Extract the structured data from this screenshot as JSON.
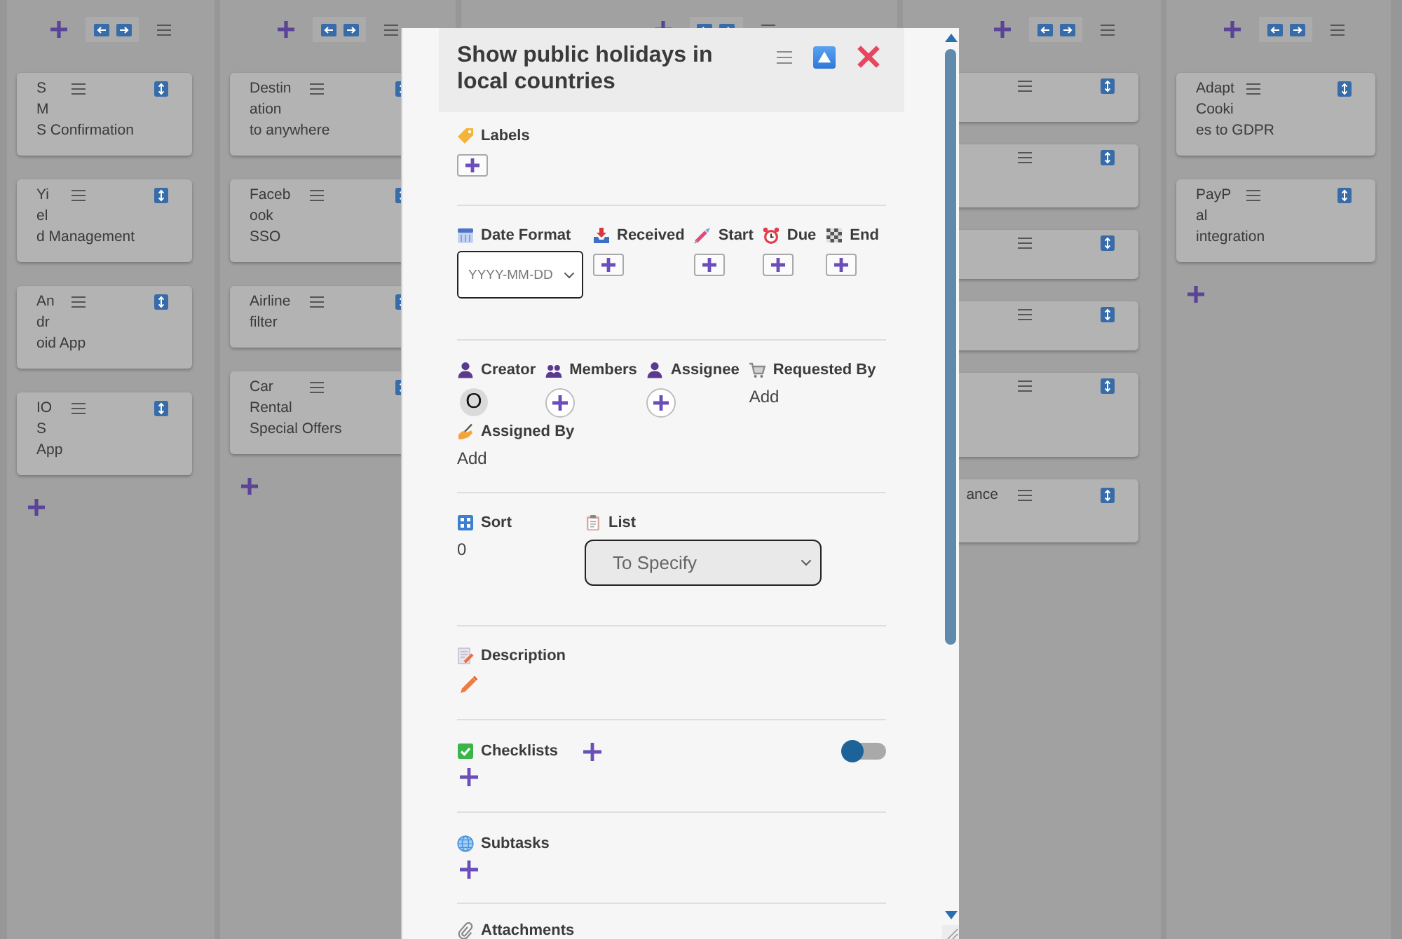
{
  "board": {
    "columns": [
      {
        "cards": [
          {
            "kind": "card",
            "title_lines": [
              "S",
              "M",
              "S Confirmation"
            ]
          },
          {
            "kind": "card",
            "title_lines": [
              "Yi",
              "el",
              "d Management"
            ]
          },
          {
            "kind": "card",
            "title_lines": [
              "An",
              "dr",
              "oid App"
            ]
          },
          {
            "kind": "card",
            "title_lines": [
              "IO",
              "S",
              "App"
            ]
          }
        ]
      },
      {
        "cards": [
          {
            "kind": "card",
            "title_lines": [
              "Destin",
              "ation",
              "to anywhere"
            ]
          },
          {
            "kind": "card",
            "title_lines": [
              "Faceb",
              "ook",
              "SSO"
            ]
          },
          {
            "kind": "card",
            "title_lines": [
              "Airline",
              "filter"
            ]
          },
          {
            "kind": "card",
            "title_lines": [
              "Car",
              "Rental",
              "Special Offers"
            ]
          }
        ]
      },
      {},
      {
        "cards": [
          {
            "kind": "clipped"
          },
          {
            "kind": "clipped"
          },
          {
            "kind": "clipped"
          },
          {
            "kind": "clipped"
          },
          {
            "kind": "clipped"
          },
          {
            "kind": "clipped",
            "title_lines": [
              "ance"
            ]
          }
        ]
      },
      {
        "cards": [
          {
            "kind": "card",
            "title_lines": [
              "Adapt",
              "Cooki",
              "es to GDPR"
            ]
          },
          {
            "kind": "card",
            "title_lines": [
              "PayP",
              "al",
              "integration"
            ]
          }
        ]
      }
    ]
  },
  "card_dialog": {
    "title": "Show public holidays in local countries",
    "sections": [
      {
        "fields": [
          {
            "kind": "add-box",
            "label": "Labels"
          }
        ]
      },
      {
        "fields": [
          {
            "kind": "date-select",
            "label": "Date Format",
            "placeholder": "YYYY-MM-DD"
          },
          {
            "kind": "add-box",
            "label": "Received"
          },
          {
            "kind": "add-box",
            "label": "Start"
          },
          {
            "kind": "add-box",
            "label": "Due"
          },
          {
            "kind": "add-box",
            "label": "End"
          }
        ]
      },
      {
        "fields": [
          {
            "kind": "avatar",
            "label": "Creator",
            "initial": "O"
          },
          {
            "kind": "add-circle",
            "label": "Members"
          },
          {
            "kind": "add-circle",
            "label": "Assignee"
          },
          {
            "kind": "link",
            "label": "Requested By",
            "value": "Add"
          },
          {
            "kind": "link",
            "label": "Assigned By",
            "value": "Add"
          }
        ]
      },
      {
        "fields": [
          {
            "kind": "text",
            "label": "Sort",
            "value": "0"
          },
          {
            "kind": "list-select",
            "label": "List",
            "value": "To Specify"
          }
        ]
      },
      {
        "fields": [
          {
            "kind": "edit",
            "label": "Description"
          }
        ]
      },
      {
        "fields": [
          {
            "kind": "checklists",
            "label": "Checklists",
            "toggle_on": false
          }
        ]
      },
      {
        "fields": [
          {
            "kind": "add-plus",
            "label": "Subtasks"
          }
        ]
      },
      {
        "fields": [
          {
            "kind": "heading",
            "label": "Attachments"
          }
        ]
      }
    ]
  }
}
